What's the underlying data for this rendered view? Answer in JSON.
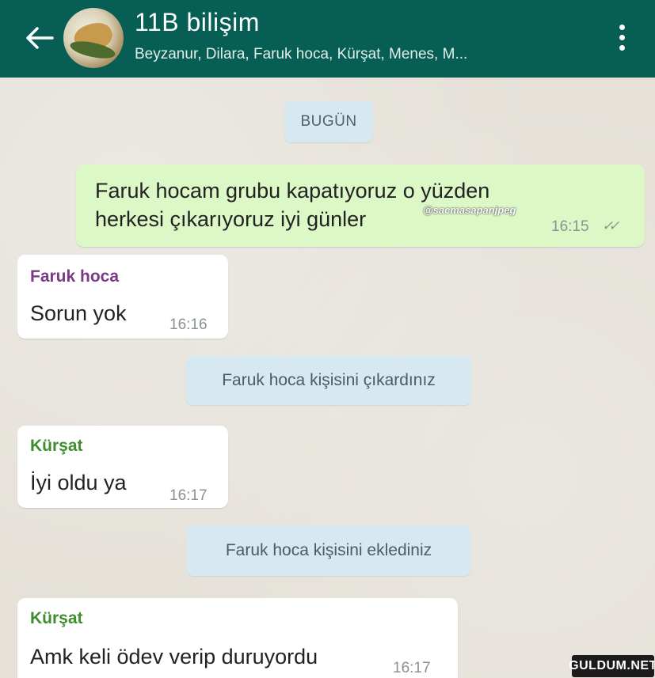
{
  "header": {
    "title": "11B bilişim",
    "members": "Beyzanur, Dilara, Faruk hoca, Kürşat, Menes, M..."
  },
  "date_divider": "BUGÜN",
  "messages": [
    {
      "text_line1": "Faruk hocam grubu kapatıyoruz o yüzden",
      "text_line2": "herkesi çıkarıyoruz iyi günler",
      "time": "16:15",
      "ticks": "✓✓"
    },
    {
      "sender": "Faruk hoca",
      "text": "Sorun yok",
      "time": "16:16"
    },
    {
      "system": "Faruk hoca kişisini çıkardınız"
    },
    {
      "sender": "Kürşat",
      "text": "İyi oldu ya",
      "time": "16:17"
    },
    {
      "system": "Faruk hoca kişisini eklediniz"
    },
    {
      "sender": "Kürşat",
      "text": "Amk keli ödev verip duruyordu",
      "time": "16:17"
    }
  ],
  "watermark": "@sacmasapanjpeg",
  "site_logo": "GULDUM.NET",
  "colors": {
    "header": "#075e54",
    "outgoing_bubble": "#dcf8c6",
    "incoming_bubble": "#ffffff",
    "system_pill": "#d6e8f0",
    "sender_faruk": "#7a3b86",
    "sender_kursat": "#3e8e2e"
  },
  "icons": {
    "back": "back-arrow-icon",
    "menu": "more-vertical-icon",
    "read": "double-check-icon"
  }
}
